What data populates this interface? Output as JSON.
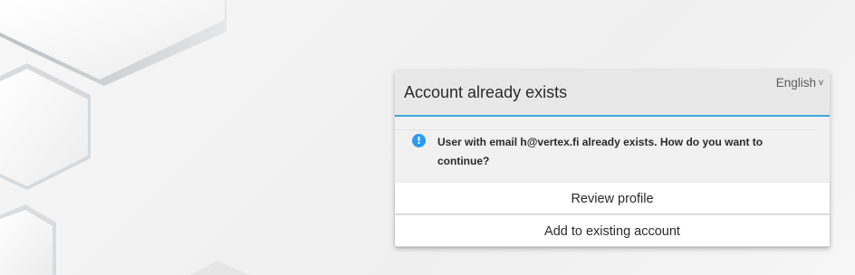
{
  "dialog": {
    "title": "Account already exists",
    "locale": "English",
    "alert": {
      "icon": "info-icon",
      "icon_glyph": "!",
      "message": "User with email h@vertex.fi already exists. How do you want to continue?"
    },
    "buttons": {
      "review_profile": "Review profile",
      "add_existing": "Add to existing account"
    }
  },
  "colors": {
    "accent": "#39a5dc",
    "info": "#2b9af3"
  }
}
